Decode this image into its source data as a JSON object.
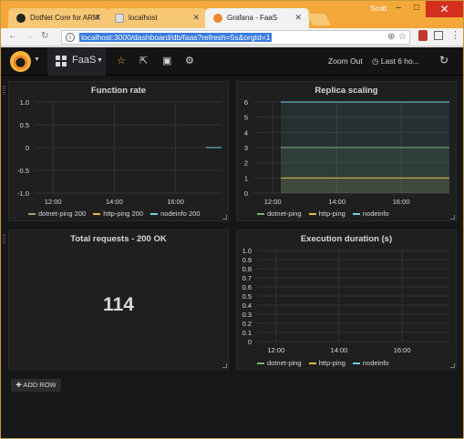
{
  "browser": {
    "tabs": [
      {
        "title": "DotNet Core for ARM",
        "icon": "github-icon"
      },
      {
        "title": "localhost",
        "icon": "page-icon"
      },
      {
        "title": "Grafana - FaaS",
        "icon": "grafana-icon",
        "active": true
      }
    ],
    "user": "Scott",
    "url": "localhost:3000/dashboard/db/faas?refresh=5s&orgId=1"
  },
  "grafana": {
    "dashboard_title": "FaaS",
    "zoom_label": "Zoom Out",
    "time_range": "Last 6 ho...",
    "add_row": "ADD ROW"
  },
  "panels": {
    "function_rate": {
      "title": "Function rate",
      "legend": [
        {
          "label": "dotnet-ping 200",
          "color": "#7eb26d"
        },
        {
          "label": "http-ping 200",
          "color": "#eab839"
        },
        {
          "label": "nodeinfo 200",
          "color": "#6ed0e0"
        }
      ]
    },
    "replica_scaling": {
      "title": "Replica scaling",
      "legend": [
        {
          "label": "dotnet-ping",
          "color": "#7eb26d"
        },
        {
          "label": "http-ping",
          "color": "#eab839"
        },
        {
          "label": "nodeinfo",
          "color": "#6ed0e0"
        }
      ]
    },
    "total_requests": {
      "title": "Total requests - 200 OK",
      "value": "114"
    },
    "execution_duration": {
      "title": "Execution duration (s)",
      "legend": [
        {
          "label": "dotnet-ping",
          "color": "#7eb26d"
        },
        {
          "label": "http-ping",
          "color": "#eab839"
        },
        {
          "label": "nodeinfo",
          "color": "#6ed0e0"
        }
      ]
    }
  },
  "chart_data": [
    {
      "type": "line",
      "title": "Function rate",
      "x_ticks": [
        "12:00",
        "14:00",
        "16:00"
      ],
      "y_ticks": [
        "1.0",
        "0.5",
        "0",
        "-0.5",
        "-1.0"
      ],
      "ylim": [
        -1.0,
        1.0
      ],
      "series": [
        {
          "name": "dotnet-ping 200",
          "points": [
            [
              "17:00",
              0
            ],
            [
              "17:30",
              0
            ]
          ]
        },
        {
          "name": "http-ping 200",
          "points": []
        },
        {
          "name": "nodeinfo 200",
          "points": [
            [
              "17:00",
              0
            ],
            [
              "17:30",
              0
            ]
          ]
        }
      ]
    },
    {
      "type": "area",
      "title": "Replica scaling",
      "x_ticks": [
        "12:00",
        "14:00",
        "16:00"
      ],
      "y_ticks": [
        "6",
        "5",
        "4",
        "3",
        "2",
        "1",
        "0"
      ],
      "ylim": [
        0,
        6
      ],
      "series": [
        {
          "name": "dotnet-ping",
          "points": [
            [
              "12:15",
              3
            ],
            [
              "17:30",
              3
            ]
          ]
        },
        {
          "name": "http-ping",
          "points": [
            [
              "12:15",
              1
            ],
            [
              "17:30",
              1
            ]
          ]
        },
        {
          "name": "nodeinfo",
          "points": [
            [
              "12:15",
              6
            ],
            [
              "17:30",
              6
            ]
          ]
        }
      ]
    },
    {
      "type": "line",
      "title": "Execution duration (s)",
      "x_ticks": [
        "12:00",
        "14:00",
        "16:00"
      ],
      "y_ticks": [
        "1.0",
        "0.9",
        "0.8",
        "0.7",
        "0.6",
        "0.5",
        "0.4",
        "0.3",
        "0.2",
        "0.1",
        "0"
      ],
      "ylim": [
        0,
        1.0
      ],
      "series": [
        {
          "name": "dotnet-ping",
          "points": []
        },
        {
          "name": "http-ping",
          "points": []
        },
        {
          "name": "nodeinfo",
          "points": []
        }
      ]
    }
  ]
}
